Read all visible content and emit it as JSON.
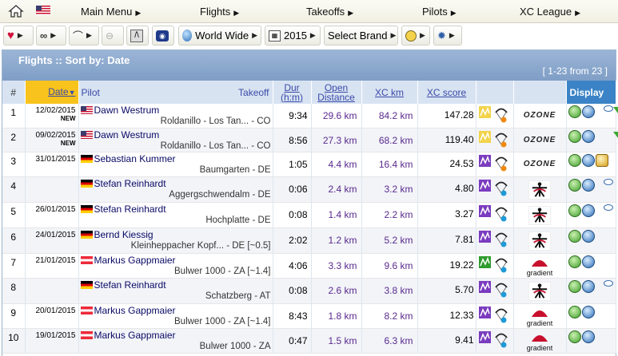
{
  "menubar": {
    "items": [
      {
        "label": "Main Menu"
      },
      {
        "label": "Flights"
      },
      {
        "label": "Takeoffs"
      },
      {
        "label": "Pilots"
      },
      {
        "label": "XC League"
      }
    ]
  },
  "toolbar": {
    "region": "World Wide",
    "year": "2015",
    "brand": "Select Brand"
  },
  "panel": {
    "title": "Flights :: Sort by: Date",
    "count": "[ 1-23 from 23 ]"
  },
  "columns": {
    "num": "#",
    "date": "Date",
    "pilot": "Pilot",
    "takeoff": "Takeoff",
    "dur": "Dur\n(h:m)",
    "dur_l1": "Dur",
    "dur_l2": "(h:m)",
    "open_l1": "Open",
    "open_l2": "Distance",
    "xc_km": "XC km",
    "xc_score": "XC score",
    "display": "Display"
  },
  "rows": [
    {
      "num": "1",
      "date": "12/02/2015",
      "new": "NEW",
      "flag": "us",
      "pilot": "Dawn Westrum",
      "takeoff": "Roldanillo - Los Tan... - CO",
      "dur": "9:34",
      "open": "29.6 km",
      "xc": "84.2 km",
      "score": "147.28",
      "chart": "yellow",
      "brand": "ozone",
      "comment": true,
      "tri": true,
      "camera": false
    },
    {
      "num": "2",
      "date": "09/02/2015",
      "new": "NEW",
      "flag": "us",
      "pilot": "Dawn Westrum",
      "takeoff": "Roldanillo - Los Tan... - CO",
      "dur": "8:56",
      "open": "27.3 km",
      "xc": "68.2 km",
      "score": "119.40",
      "chart": "yellow",
      "brand": "ozone",
      "comment": false,
      "tri": true,
      "camera": false
    },
    {
      "num": "3",
      "date": "31/01/2015",
      "new": "",
      "flag": "de",
      "pilot": "Sebastian Kummer",
      "takeoff": "Baumgarten - DE",
      "dur": "1:05",
      "open": "4.4 km",
      "xc": "16.4 km",
      "score": "24.53",
      "chart": "purple",
      "brand": "ozone",
      "comment": false,
      "tri": false,
      "camera": true
    },
    {
      "num": "4",
      "date": "",
      "new": "",
      "flag": "de",
      "pilot": "Stefan Reinhardt",
      "takeoff": "Aggergschwendalm - DE",
      "dur": "0:06",
      "open": "2.4 km",
      "xc": "3.2 km",
      "score": "4.80",
      "chart": "purple",
      "brand": "skywalk",
      "comment": true,
      "tri": false,
      "camera": false
    },
    {
      "num": "5",
      "date": "26/01/2015",
      "new": "",
      "flag": "de",
      "pilot": "Stefan Reinhardt",
      "takeoff": "Hochplatte - DE",
      "dur": "0:08",
      "open": "1.4 km",
      "xc": "2.2 km",
      "score": "3.27",
      "chart": "purple",
      "brand": "skywalk",
      "comment": true,
      "tri": false,
      "camera": false
    },
    {
      "num": "6",
      "date": "24/01/2015",
      "new": "",
      "flag": "de",
      "pilot": "Bernd Kiessig",
      "takeoff": "Kleinheppacher Kopf... - DE [~0.5]",
      "dur": "2:02",
      "open": "1.2 km",
      "xc": "5.2 km",
      "score": "7.81",
      "chart": "purple",
      "brand": "skywalk",
      "comment": false,
      "tri": false,
      "camera": false
    },
    {
      "num": "7",
      "date": "21/01/2015",
      "new": "",
      "flag": "at",
      "pilot": "Markus Gappmaier",
      "takeoff": "Bulwer 1000 - ZA [~1.4]",
      "dur": "4:06",
      "open": "3.3 km",
      "xc": "9.6 km",
      "score": "19.22",
      "chart": "green",
      "brand": "gradient",
      "comment": false,
      "tri": false,
      "camera": false
    },
    {
      "num": "8",
      "date": "",
      "new": "",
      "flag": "de",
      "pilot": "Stefan Reinhardt",
      "takeoff": "Schatzberg - AT",
      "dur": "0:08",
      "open": "2.6 km",
      "xc": "3.8 km",
      "score": "5.70",
      "chart": "purple",
      "brand": "skywalk",
      "comment": true,
      "tri": false,
      "camera": false
    },
    {
      "num": "9",
      "date": "20/01/2015",
      "new": "",
      "flag": "at",
      "pilot": "Markus Gappmaier",
      "takeoff": "Bulwer 1000 - ZA [~1.4]",
      "dur": "8:43",
      "open": "1.8 km",
      "xc": "8.2 km",
      "score": "12.33",
      "chart": "purple",
      "brand": "gradient",
      "comment": false,
      "tri": false,
      "camera": false
    },
    {
      "num": "10",
      "date": "19/01/2015",
      "new": "",
      "flag": "at",
      "pilot": "Markus Gappmaier",
      "takeoff": "Bulwer 1000 - ZA",
      "dur": "0:47",
      "open": "1.5 km",
      "xc": "6.3 km",
      "score": "9.41",
      "chart": "purple",
      "brand": "gradient",
      "comment": false,
      "tri": false,
      "camera": false
    }
  ],
  "brands": {
    "ozone": "OZONE",
    "gradient": "gradient"
  },
  "colors": {
    "header_bg": "#8aa7cc",
    "date_col": "#f7c31c",
    "display_col": "#3b83c6",
    "distance": "#5a2a8e"
  }
}
